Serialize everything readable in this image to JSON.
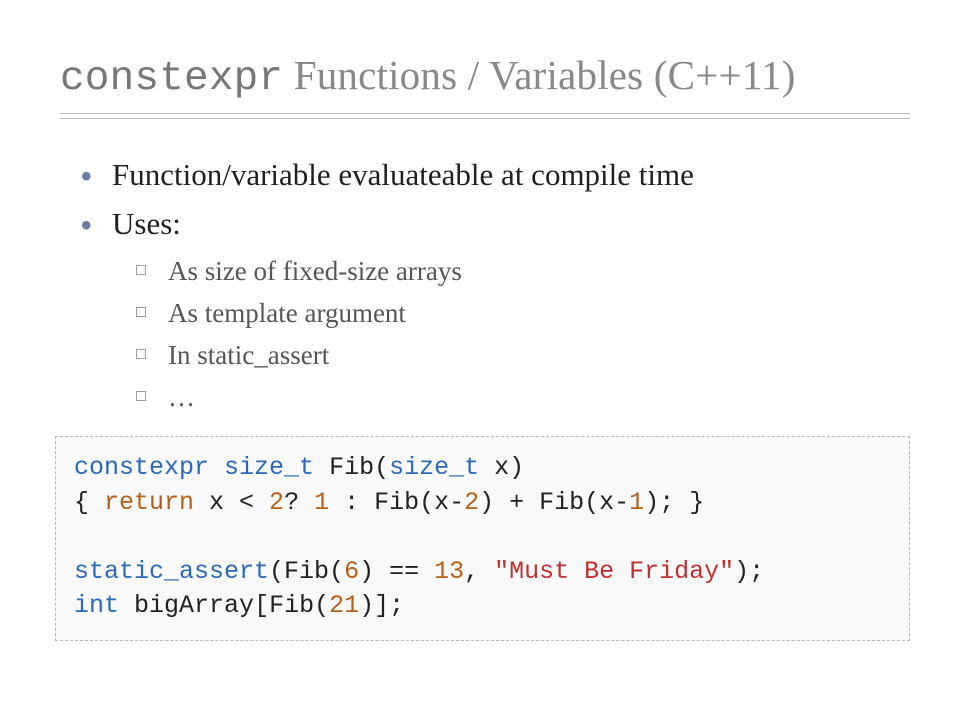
{
  "title": {
    "code_part": "constexpr",
    "rest": " Functions / Variables (C++11)"
  },
  "bullets": [
    "Function/variable evaluateable at compile time",
    "Uses:"
  ],
  "sub_bullets": [
    "As size of fixed-size arrays",
    "As template argument",
    "In static_assert",
    "…"
  ],
  "code": {
    "l1_kw1": "constexpr",
    "l1_sp1": " ",
    "l1_kw2": "size_t",
    "l1_sp2": " ",
    "l1_fn": "Fib",
    "l1_p1": "(",
    "l1_kw3": "size_t",
    "l1_sp3": " ",
    "l1_arg": "x",
    "l1_p2": ")",
    "l2_open": "{ ",
    "l2_ret": "return",
    "l2_body": " x < ",
    "l2_n2": "2",
    "l2_q": "? ",
    "l2_n1": "1",
    "l2_col": " : Fib(x-",
    "l2_n2b": "2",
    "l2_mid": ") + Fib(x-",
    "l2_n1b": "1",
    "l2_end": "); }",
    "l4_kw": "static_assert",
    "l4_open": "(Fib(",
    "l4_n6": "6",
    "l4_eq": ") == ",
    "l4_n13": "13",
    "l4_comma": ", ",
    "l4_str": "\"Must Be Friday\"",
    "l4_close": ");",
    "l5_kw": "int",
    "l5_sp": " ",
    "l5_id": "bigArray",
    "l5_open": "[Fib(",
    "l5_n21": "21",
    "l5_close": ")];"
  }
}
